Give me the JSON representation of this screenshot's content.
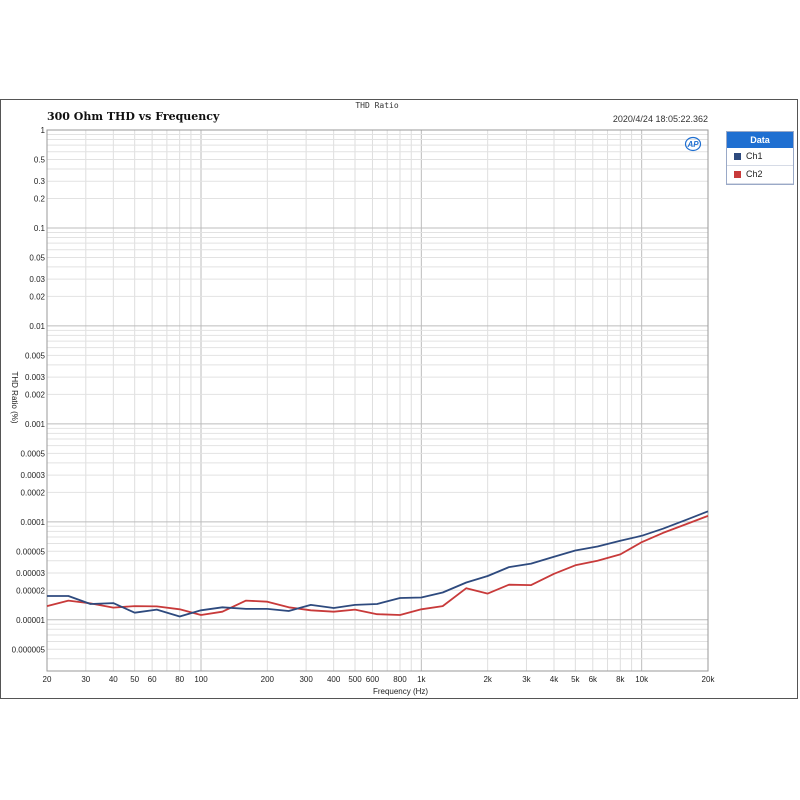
{
  "header": {
    "top_title": "THD Ratio",
    "timestamp": "2020/4/24 18:05:22.362"
  },
  "legend": {
    "title": "Data",
    "items": [
      {
        "label": "Ch1",
        "color": "#2e4a7e"
      },
      {
        "label": "Ch2",
        "color": "#c83a3a"
      }
    ]
  },
  "logo": {
    "icon": "ap-logo-icon",
    "text": "AP"
  },
  "chart_data": {
    "type": "line",
    "title": "300 Ohm THD vs Frequency",
    "xlabel": "Frequency (Hz)",
    "ylabel": "THD Ratio (%)",
    "x_scale": "log",
    "y_scale": "log",
    "xlim": [
      20,
      20000
    ],
    "ylim": [
      3e-06,
      1
    ],
    "grid": true,
    "legend_position": "outside-right",
    "x_ticks": [
      {
        "v": 20,
        "label": "20"
      },
      {
        "v": 30,
        "label": "30"
      },
      {
        "v": 40,
        "label": "40"
      },
      {
        "v": 50,
        "label": "50"
      },
      {
        "v": 60,
        "label": "60"
      },
      {
        "v": 80,
        "label": "80"
      },
      {
        "v": 100,
        "label": "100"
      },
      {
        "v": 200,
        "label": "200"
      },
      {
        "v": 300,
        "label": "300"
      },
      {
        "v": 400,
        "label": "400"
      },
      {
        "v": 500,
        "label": "500"
      },
      {
        "v": 600,
        "label": "600"
      },
      {
        "v": 800,
        "label": "800"
      },
      {
        "v": 1000,
        "label": "1k"
      },
      {
        "v": 2000,
        "label": "2k"
      },
      {
        "v": 3000,
        "label": "3k"
      },
      {
        "v": 4000,
        "label": "4k"
      },
      {
        "v": 5000,
        "label": "5k"
      },
      {
        "v": 6000,
        "label": "6k"
      },
      {
        "v": 8000,
        "label": "8k"
      },
      {
        "v": 10000,
        "label": "10k"
      },
      {
        "v": 20000,
        "label": "20k"
      }
    ],
    "y_ticks": [
      {
        "v": 1,
        "label": "1"
      },
      {
        "v": 0.5,
        "label": "0.5"
      },
      {
        "v": 0.3,
        "label": "0.3"
      },
      {
        "v": 0.2,
        "label": "0.2"
      },
      {
        "v": 0.1,
        "label": "0.1"
      },
      {
        "v": 0.05,
        "label": "0.05"
      },
      {
        "v": 0.03,
        "label": "0.03"
      },
      {
        "v": 0.02,
        "label": "0.02"
      },
      {
        "v": 0.01,
        "label": "0.01"
      },
      {
        "v": 0.005,
        "label": "0.005"
      },
      {
        "v": 0.003,
        "label": "0.003"
      },
      {
        "v": 0.002,
        "label": "0.002"
      },
      {
        "v": 0.001,
        "label": "0.001"
      },
      {
        "v": 0.0005,
        "label": "0.0005"
      },
      {
        "v": 0.0003,
        "label": "0.0003"
      },
      {
        "v": 0.0002,
        "label": "0.0002"
      },
      {
        "v": 0.0001,
        "label": "0.0001"
      },
      {
        "v": 5e-05,
        "label": "0.00005"
      },
      {
        "v": 3e-05,
        "label": "0.00003"
      },
      {
        "v": 2e-05,
        "label": "0.00002"
      },
      {
        "v": 1e-05,
        "label": "0.00001"
      },
      {
        "v": 5e-06,
        "label": "0.000005"
      }
    ],
    "series": [
      {
        "name": "Ch1",
        "color": "#2e4a7e",
        "x": [
          20,
          25,
          31.5,
          40,
          50,
          63,
          80,
          100,
          125,
          160,
          200,
          250,
          315,
          400,
          500,
          630,
          800,
          1000,
          1250,
          1600,
          2000,
          2500,
          3150,
          4000,
          5000,
          6300,
          8000,
          10000,
          12500,
          16000,
          20000
        ],
        "y": [
          1.75e-05,
          1.75e-05,
          1.45e-05,
          1.48e-05,
          1.18e-05,
          1.27e-05,
          1.08e-05,
          1.25e-05,
          1.34e-05,
          1.29e-05,
          1.29e-05,
          1.23e-05,
          1.42e-05,
          1.32e-05,
          1.42e-05,
          1.45e-05,
          1.67e-05,
          1.69e-05,
          1.9e-05,
          2.4e-05,
          2.8e-05,
          3.45e-05,
          3.75e-05,
          4.4e-05,
          5.1e-05,
          5.6e-05,
          6.4e-05,
          7.2e-05,
          8.5e-05,
          0.000105,
          0.000128
        ]
      },
      {
        "name": "Ch2",
        "color": "#c83a3a",
        "x": [
          20,
          25,
          31.5,
          40,
          50,
          63,
          80,
          100,
          125,
          160,
          200,
          250,
          315,
          400,
          500,
          630,
          800,
          1000,
          1250,
          1600,
          2000,
          2500,
          3150,
          4000,
          5000,
          6300,
          8000,
          10000,
          12500,
          16000,
          20000
        ],
        "y": [
          1.38e-05,
          1.57e-05,
          1.47e-05,
          1.33e-05,
          1.38e-05,
          1.37e-05,
          1.28e-05,
          1.12e-05,
          1.21e-05,
          1.57e-05,
          1.53e-05,
          1.34e-05,
          1.25e-05,
          1.21e-05,
          1.27e-05,
          1.14e-05,
          1.12e-05,
          1.28e-05,
          1.38e-05,
          2.1e-05,
          1.85e-05,
          2.28e-05,
          2.26e-05,
          2.95e-05,
          3.6e-05,
          4e-05,
          4.65e-05,
          6.2e-05,
          7.7e-05,
          9.5e-05,
          0.000115
        ]
      }
    ]
  }
}
